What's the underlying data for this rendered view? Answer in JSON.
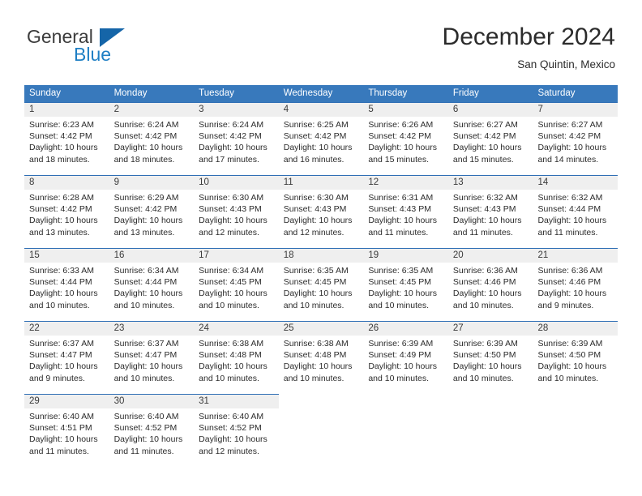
{
  "logo": {
    "line1": "General",
    "line2": "Blue",
    "triangle_color": "#1565a8",
    "blue_text_color": "#1f7fc4"
  },
  "header": {
    "title": "December 2024",
    "subtitle": "San Quintin, Mexico"
  },
  "colors": {
    "header_blue": "#3879bc",
    "row_rule_blue": "#2f6fb5",
    "day_band_gray": "#efefef"
  },
  "weekdays": [
    "Sunday",
    "Monday",
    "Tuesday",
    "Wednesday",
    "Thursday",
    "Friday",
    "Saturday"
  ],
  "weeks": [
    [
      {
        "day": "1",
        "sunrise": "Sunrise: 6:23 AM",
        "sunset": "Sunset: 4:42 PM",
        "daylight": "Daylight: 10 hours and 18 minutes."
      },
      {
        "day": "2",
        "sunrise": "Sunrise: 6:24 AM",
        "sunset": "Sunset: 4:42 PM",
        "daylight": "Daylight: 10 hours and 18 minutes."
      },
      {
        "day": "3",
        "sunrise": "Sunrise: 6:24 AM",
        "sunset": "Sunset: 4:42 PM",
        "daylight": "Daylight: 10 hours and 17 minutes."
      },
      {
        "day": "4",
        "sunrise": "Sunrise: 6:25 AM",
        "sunset": "Sunset: 4:42 PM",
        "daylight": "Daylight: 10 hours and 16 minutes."
      },
      {
        "day": "5",
        "sunrise": "Sunrise: 6:26 AM",
        "sunset": "Sunset: 4:42 PM",
        "daylight": "Daylight: 10 hours and 15 minutes."
      },
      {
        "day": "6",
        "sunrise": "Sunrise: 6:27 AM",
        "sunset": "Sunset: 4:42 PM",
        "daylight": "Daylight: 10 hours and 15 minutes."
      },
      {
        "day": "7",
        "sunrise": "Sunrise: 6:27 AM",
        "sunset": "Sunset: 4:42 PM",
        "daylight": "Daylight: 10 hours and 14 minutes."
      }
    ],
    [
      {
        "day": "8",
        "sunrise": "Sunrise: 6:28 AM",
        "sunset": "Sunset: 4:42 PM",
        "daylight": "Daylight: 10 hours and 13 minutes."
      },
      {
        "day": "9",
        "sunrise": "Sunrise: 6:29 AM",
        "sunset": "Sunset: 4:42 PM",
        "daylight": "Daylight: 10 hours and 13 minutes."
      },
      {
        "day": "10",
        "sunrise": "Sunrise: 6:30 AM",
        "sunset": "Sunset: 4:43 PM",
        "daylight": "Daylight: 10 hours and 12 minutes."
      },
      {
        "day": "11",
        "sunrise": "Sunrise: 6:30 AM",
        "sunset": "Sunset: 4:43 PM",
        "daylight": "Daylight: 10 hours and 12 minutes."
      },
      {
        "day": "12",
        "sunrise": "Sunrise: 6:31 AM",
        "sunset": "Sunset: 4:43 PM",
        "daylight": "Daylight: 10 hours and 11 minutes."
      },
      {
        "day": "13",
        "sunrise": "Sunrise: 6:32 AM",
        "sunset": "Sunset: 4:43 PM",
        "daylight": "Daylight: 10 hours and 11 minutes."
      },
      {
        "day": "14",
        "sunrise": "Sunrise: 6:32 AM",
        "sunset": "Sunset: 4:44 PM",
        "daylight": "Daylight: 10 hours and 11 minutes."
      }
    ],
    [
      {
        "day": "15",
        "sunrise": "Sunrise: 6:33 AM",
        "sunset": "Sunset: 4:44 PM",
        "daylight": "Daylight: 10 hours and 10 minutes."
      },
      {
        "day": "16",
        "sunrise": "Sunrise: 6:34 AM",
        "sunset": "Sunset: 4:44 PM",
        "daylight": "Daylight: 10 hours and 10 minutes."
      },
      {
        "day": "17",
        "sunrise": "Sunrise: 6:34 AM",
        "sunset": "Sunset: 4:45 PM",
        "daylight": "Daylight: 10 hours and 10 minutes."
      },
      {
        "day": "18",
        "sunrise": "Sunrise: 6:35 AM",
        "sunset": "Sunset: 4:45 PM",
        "daylight": "Daylight: 10 hours and 10 minutes."
      },
      {
        "day": "19",
        "sunrise": "Sunrise: 6:35 AM",
        "sunset": "Sunset: 4:45 PM",
        "daylight": "Daylight: 10 hours and 10 minutes."
      },
      {
        "day": "20",
        "sunrise": "Sunrise: 6:36 AM",
        "sunset": "Sunset: 4:46 PM",
        "daylight": "Daylight: 10 hours and 10 minutes."
      },
      {
        "day": "21",
        "sunrise": "Sunrise: 6:36 AM",
        "sunset": "Sunset: 4:46 PM",
        "daylight": "Daylight: 10 hours and 9 minutes."
      }
    ],
    [
      {
        "day": "22",
        "sunrise": "Sunrise: 6:37 AM",
        "sunset": "Sunset: 4:47 PM",
        "daylight": "Daylight: 10 hours and 9 minutes."
      },
      {
        "day": "23",
        "sunrise": "Sunrise: 6:37 AM",
        "sunset": "Sunset: 4:47 PM",
        "daylight": "Daylight: 10 hours and 10 minutes."
      },
      {
        "day": "24",
        "sunrise": "Sunrise: 6:38 AM",
        "sunset": "Sunset: 4:48 PM",
        "daylight": "Daylight: 10 hours and 10 minutes."
      },
      {
        "day": "25",
        "sunrise": "Sunrise: 6:38 AM",
        "sunset": "Sunset: 4:48 PM",
        "daylight": "Daylight: 10 hours and 10 minutes."
      },
      {
        "day": "26",
        "sunrise": "Sunrise: 6:39 AM",
        "sunset": "Sunset: 4:49 PM",
        "daylight": "Daylight: 10 hours and 10 minutes."
      },
      {
        "day": "27",
        "sunrise": "Sunrise: 6:39 AM",
        "sunset": "Sunset: 4:50 PM",
        "daylight": "Daylight: 10 hours and 10 minutes."
      },
      {
        "day": "28",
        "sunrise": "Sunrise: 6:39 AM",
        "sunset": "Sunset: 4:50 PM",
        "daylight": "Daylight: 10 hours and 10 minutes."
      }
    ],
    [
      {
        "day": "29",
        "sunrise": "Sunrise: 6:40 AM",
        "sunset": "Sunset: 4:51 PM",
        "daylight": "Daylight: 10 hours and 11 minutes."
      },
      {
        "day": "30",
        "sunrise": "Sunrise: 6:40 AM",
        "sunset": "Sunset: 4:52 PM",
        "daylight": "Daylight: 10 hours and 11 minutes."
      },
      {
        "day": "31",
        "sunrise": "Sunrise: 6:40 AM",
        "sunset": "Sunset: 4:52 PM",
        "daylight": "Daylight: 10 hours and 12 minutes."
      },
      {
        "day": "",
        "sunrise": "",
        "sunset": "",
        "daylight": ""
      },
      {
        "day": "",
        "sunrise": "",
        "sunset": "",
        "daylight": ""
      },
      {
        "day": "",
        "sunrise": "",
        "sunset": "",
        "daylight": ""
      },
      {
        "day": "",
        "sunrise": "",
        "sunset": "",
        "daylight": ""
      }
    ]
  ]
}
